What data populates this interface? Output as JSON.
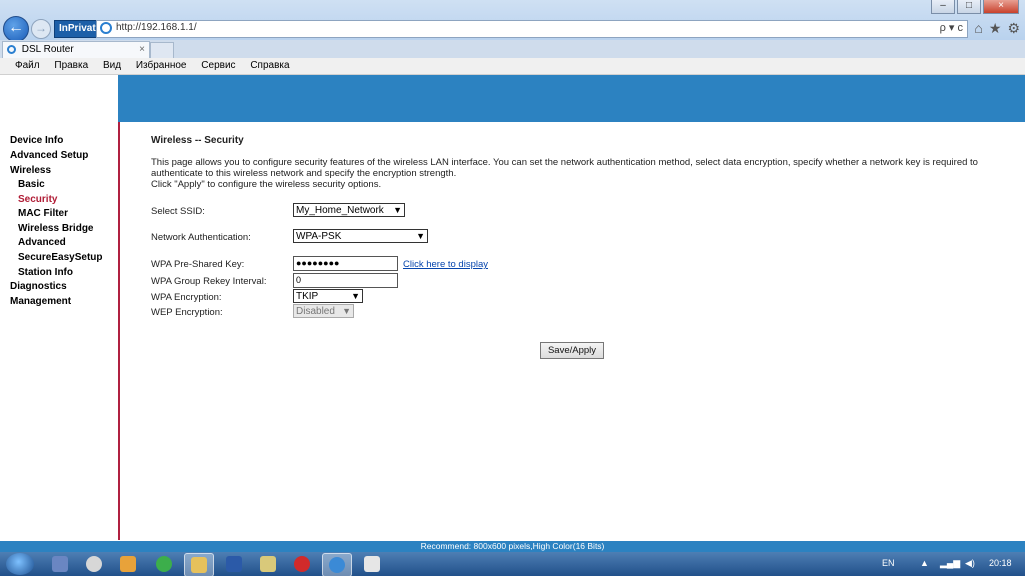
{
  "browser": {
    "back_glyph": "←",
    "forward_glyph": "→",
    "inprivate_label": "InPrivate",
    "address_url": "http://192.168.1.1/",
    "address_tools": "ρ ▾ c",
    "tab_title": "DSL Router",
    "tab_close": "×",
    "window_min": "–",
    "window_max": "□",
    "window_close": "×",
    "home_icon": "⌂",
    "favorites_icon": "★",
    "tools_icon": "⚙"
  },
  "menu": [
    "Файл",
    "Правка",
    "Вид",
    "Избранное",
    "Сервис",
    "Справка"
  ],
  "sidebar": {
    "items": [
      {
        "label": "Device Info"
      },
      {
        "label": "Advanced Setup"
      },
      {
        "label": "Wireless"
      },
      {
        "label": "Basic"
      },
      {
        "label": "Security"
      },
      {
        "label": "MAC Filter"
      },
      {
        "label": "Wireless Bridge"
      },
      {
        "label": "Advanced"
      },
      {
        "label": "SecureEasySetup"
      },
      {
        "label": "Station Info"
      },
      {
        "label": "Diagnostics"
      },
      {
        "label": "Management"
      }
    ]
  },
  "content": {
    "title": "Wireless -- Security",
    "description_line1": "This page allows you to configure security features of the wireless LAN interface. You can set the network authentication method, select data encryption, specify whether a network key is required to",
    "description_line2": "authenticate to this wireless network and specify the encryption strength.",
    "description_line3": "Click \"Apply\" to configure the wireless security options.",
    "ssid_label": "Select SSID:",
    "ssid_value": "My_Home_Network",
    "auth_label": "Network Authentication:",
    "auth_value": "WPA-PSK",
    "psk_label": "WPA Pre-Shared Key:",
    "psk_value": "●●●●●●●●",
    "psk_link": "Click here to display",
    "rekey_label": "WPA Group Rekey Interval:",
    "rekey_value": "0",
    "wpa_enc_label": "WPA Encryption:",
    "wpa_enc_value": "TKIP",
    "wep_enc_label": "WEP Encryption:",
    "wep_enc_value": "Disabled",
    "save_button": "Save/Apply"
  },
  "status_bar": "Recommend: 800x600 pixels,High Color(16 Bits)",
  "taskbar": {
    "language": "EN",
    "clock": "20:18"
  },
  "colors": {
    "header_blue": "#2c82c1",
    "active_nav": "#b01c35",
    "sidebar_border": "#b02040"
  }
}
